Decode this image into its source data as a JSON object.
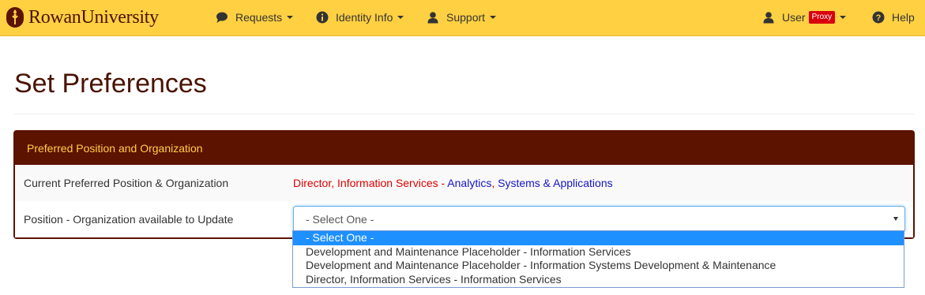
{
  "header": {
    "brand": "RowanUniversity",
    "menus": [
      {
        "label": "Requests",
        "icon": "comment-icon"
      },
      {
        "label": "Identity Info",
        "icon": "info-icon"
      },
      {
        "label": "Support",
        "icon": "user-icon"
      }
    ],
    "user": {
      "label": "User",
      "badge": "Proxy",
      "icon": "user-icon"
    },
    "help": {
      "label": "Help",
      "icon": "question-icon"
    }
  },
  "page": {
    "title": "Set Preferences"
  },
  "panel": {
    "heading": "Preferred Position and Organization",
    "current": {
      "label": "Current Preferred Position & Organization",
      "position": "Director, Information Services",
      "separator": " - ",
      "org_part1": "Analytics",
      "org_sep": ", ",
      "org_part2": "Systems & Applications"
    },
    "update": {
      "label": "Position - Organization available to Update",
      "selected": "- Select One -"
    }
  },
  "dropdown": {
    "options": [
      "- Select One -",
      "Development and Maintenance Placeholder - Information Services",
      "Development and Maintenance Placeholder - Information Systems Development & Maintenance",
      "Director, Information Services - Information Services"
    ]
  },
  "colors": {
    "navbar": "#ffd042",
    "brand": "#5c1300",
    "panel_heading_text": "#ffd042",
    "current_position": "#e00000",
    "current_org": "#1515c8",
    "proxy_badge": "#d9000d",
    "option_highlight": "#1e90ff"
  }
}
